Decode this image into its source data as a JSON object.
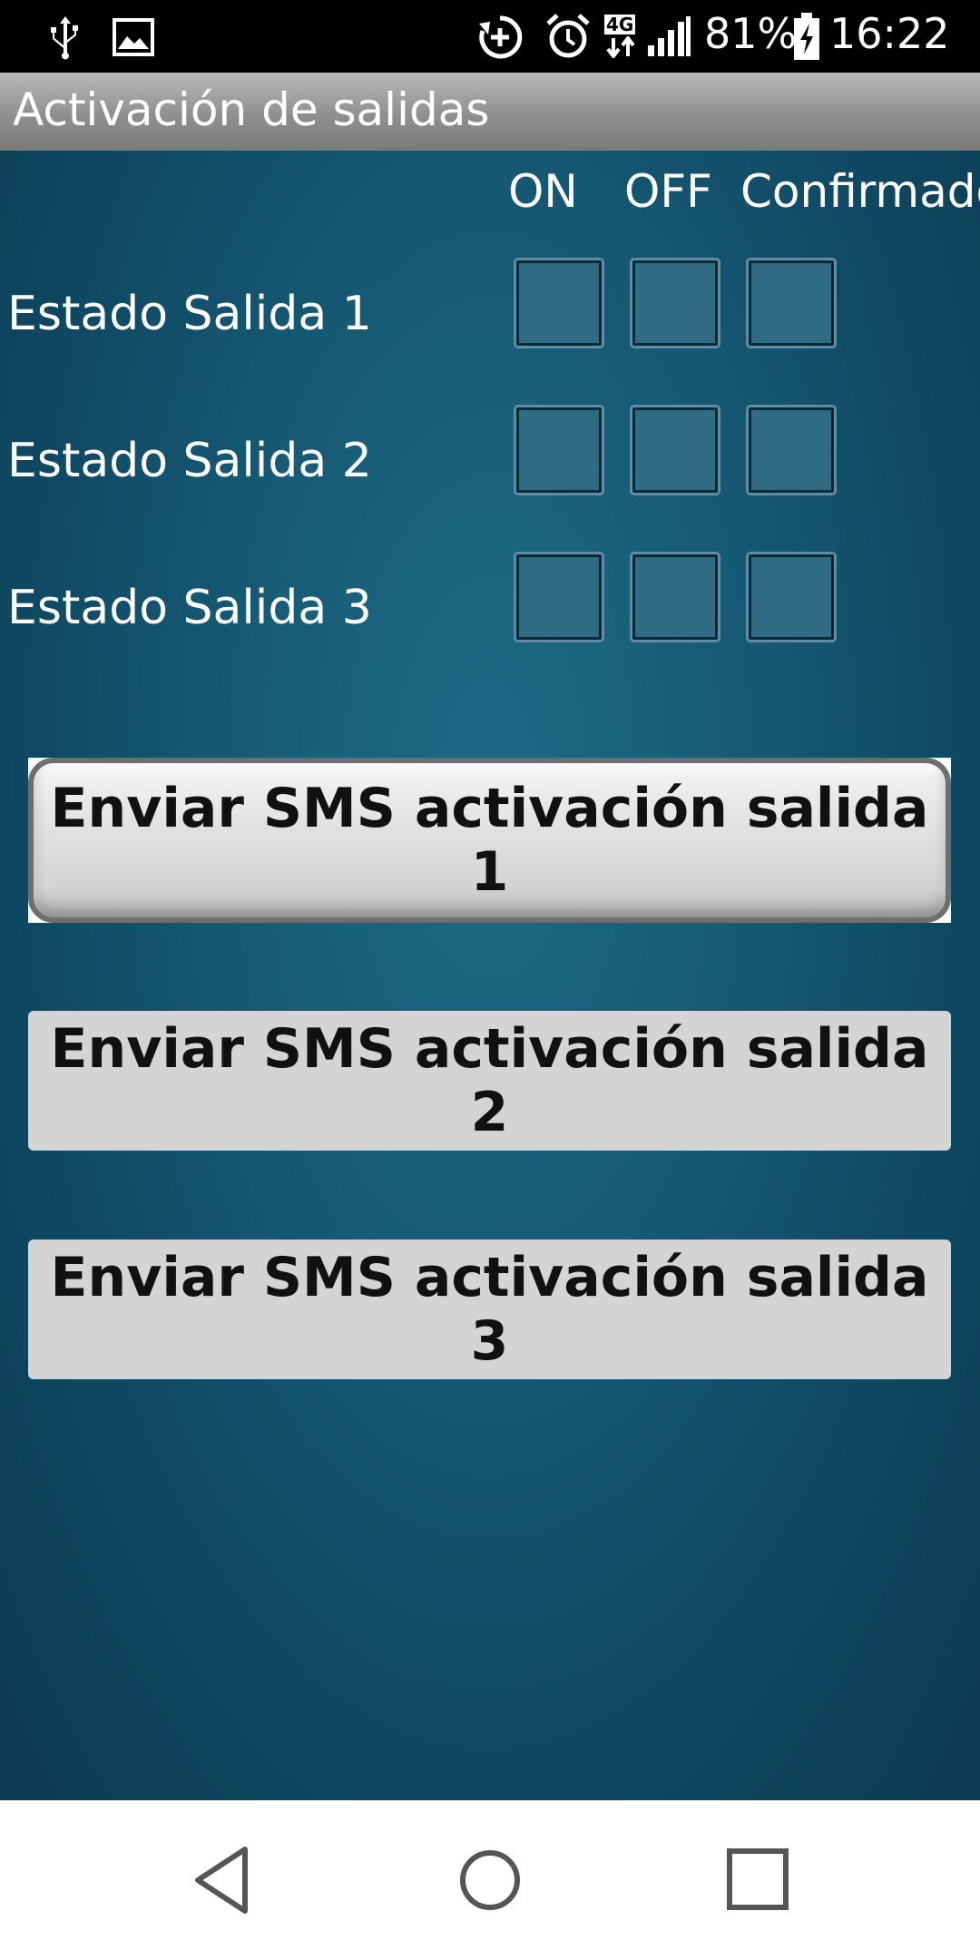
{
  "status_bar": {
    "battery": "81%",
    "time": "16:22",
    "network": "4G",
    "icons": [
      "usb-icon",
      "image-icon",
      "sync-icon",
      "alarm-icon",
      "network-4g-icon",
      "signal-icon",
      "battery-charging-icon"
    ]
  },
  "title_bar": {
    "title": "Activación de salidas"
  },
  "columns": {
    "on": "ON",
    "off": "OFF",
    "confirmed": "Confirmado"
  },
  "rows": [
    {
      "label": "Estado Salida 1"
    },
    {
      "label": "Estado Salida 2"
    },
    {
      "label": "Estado Salida 3"
    }
  ],
  "buttons": [
    {
      "label": "Enviar SMS activación salida 1"
    },
    {
      "label": "Enviar SMS activación salida 2"
    },
    {
      "label": "Enviar SMS activación salida 3"
    }
  ],
  "nav_bar": {
    "icons": [
      "back-icon",
      "home-icon",
      "recents-icon"
    ]
  },
  "colors": {
    "status_bar": "#000000",
    "title_bar": "#9a9a9a",
    "background": "#175b76",
    "button": "#d4d4d4"
  }
}
